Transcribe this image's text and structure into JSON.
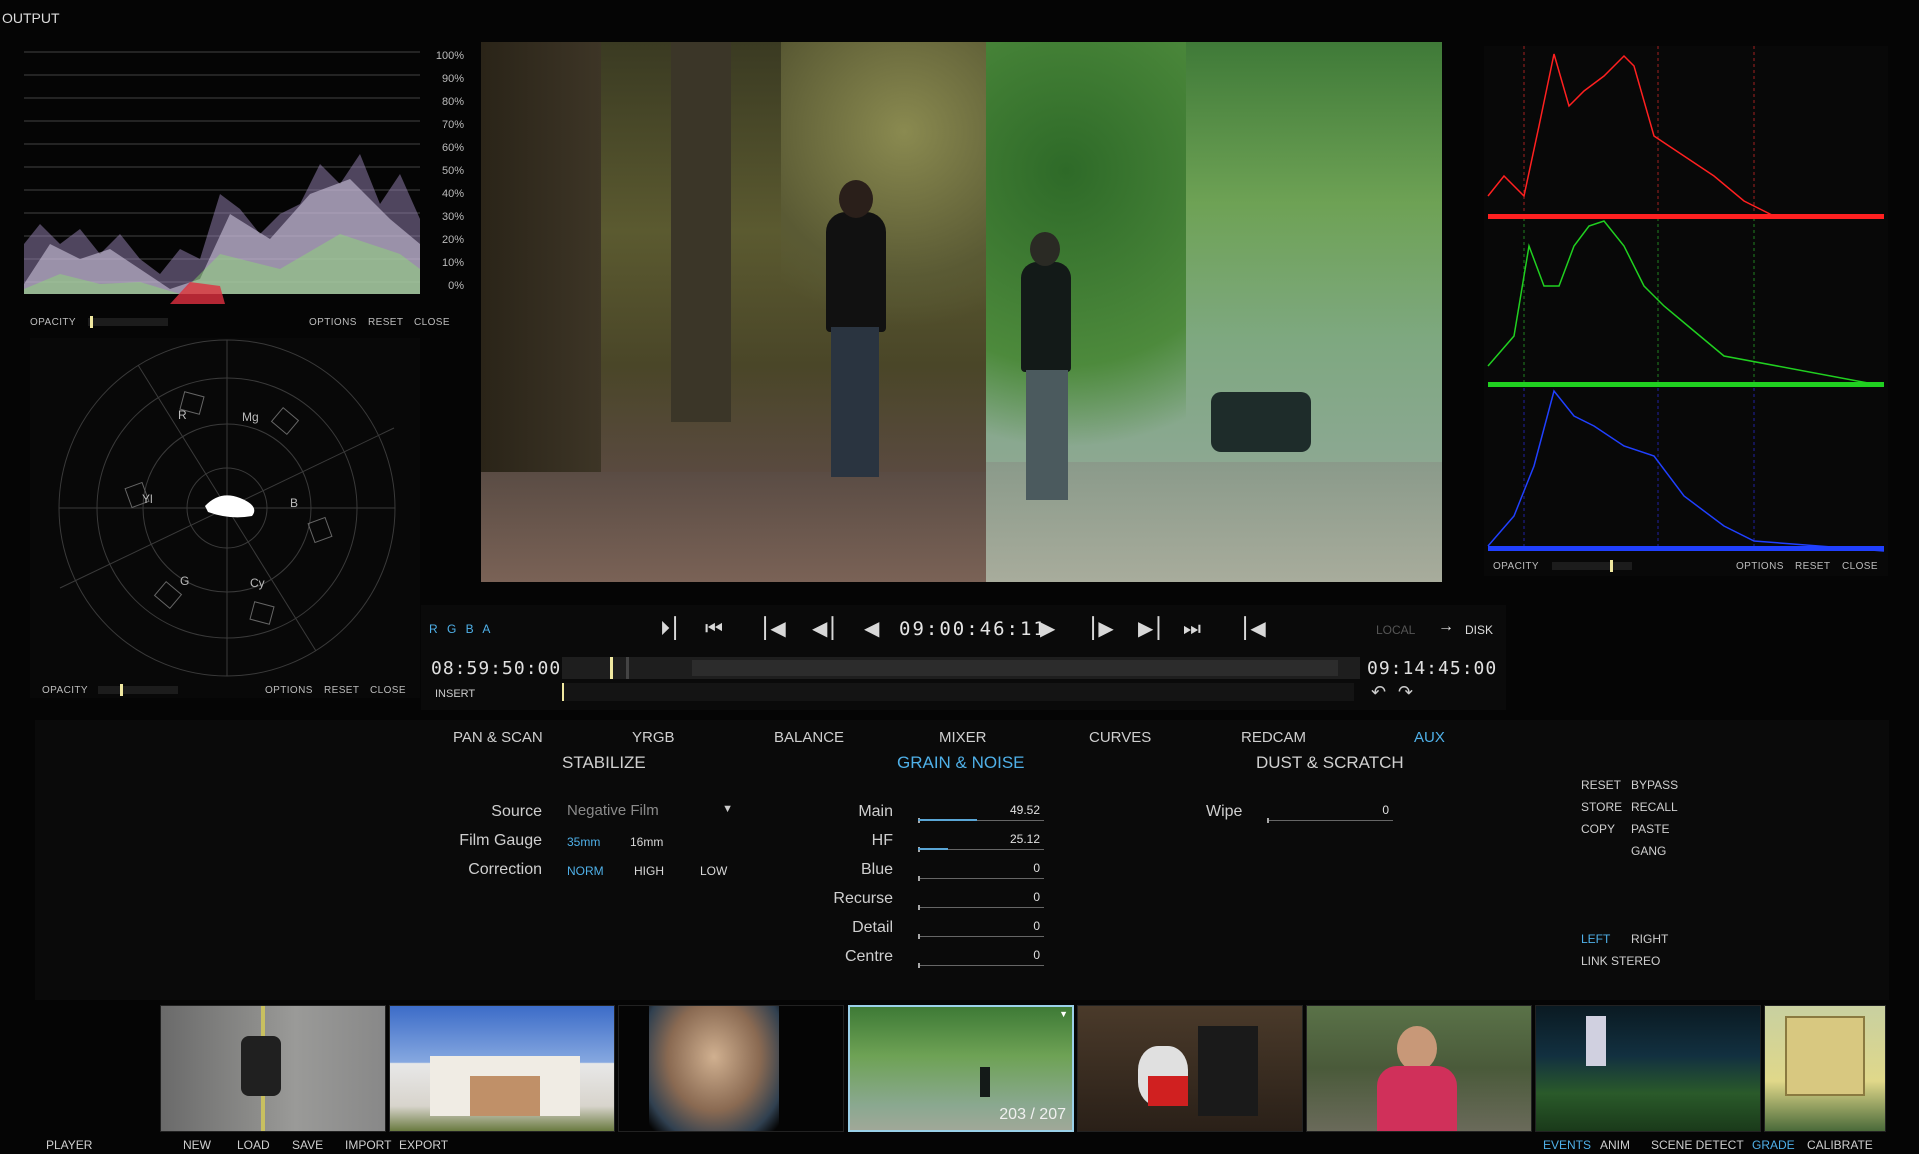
{
  "header": {
    "title": "OUTPUT"
  },
  "waveform": {
    "scale": [
      "100%",
      "90%",
      "80%",
      "70%",
      "60%",
      "50%",
      "40%",
      "30%",
      "20%",
      "10%",
      "0%"
    ],
    "opacity_label": "OPACITY",
    "options": "OPTIONS",
    "reset": "RESET",
    "close": "CLOSE"
  },
  "vectorscope": {
    "targets": [
      "R",
      "Mg",
      "B",
      "Cy",
      "G",
      "Yl"
    ],
    "opacity_label": "OPACITY",
    "options": "OPTIONS",
    "reset": "RESET",
    "close": "CLOSE"
  },
  "histogram": {
    "opacity_label": "OPACITY",
    "options": "OPTIONS",
    "reset": "RESET",
    "close": "CLOSE",
    "colors": {
      "red": "#ff2020",
      "green": "#20d020",
      "blue": "#2040ff"
    }
  },
  "transport": {
    "channels": "R G B A",
    "timecode": "09:00:46:11",
    "local": "LOCAL",
    "disk": "DISK",
    "start_tc": "08:59:50:00",
    "end_tc": "09:14:45:00",
    "insert": "INSERT"
  },
  "tabs": [
    "PAN & SCAN",
    "YRGB",
    "BALANCE",
    "MIXER",
    "CURVES",
    "REDCAM",
    "AUX"
  ],
  "active_tab": "AUX",
  "sections": {
    "stabilize": "STABILIZE",
    "grain": "GRAIN & NOISE",
    "dust": "DUST & SCRATCH"
  },
  "stabilize": {
    "source_label": "Source",
    "source_value": "Negative Film",
    "gauge_label": "Film Gauge",
    "gauge_options": [
      "35mm",
      "16mm"
    ],
    "correction_label": "Correction",
    "correction_options": [
      "NORM",
      "HIGH",
      "LOW"
    ]
  },
  "grain": {
    "sliders": [
      {
        "label": "Main",
        "value": "49.52",
        "level": 0.4952
      },
      {
        "label": "HF",
        "value": "25.12",
        "level": 0.2512
      },
      {
        "label": "Blue",
        "value": "0",
        "level": 0
      },
      {
        "label": "Recurse",
        "value": "0",
        "level": 0
      },
      {
        "label": "Detail",
        "value": "0",
        "level": 0
      },
      {
        "label": "Centre",
        "value": "0",
        "level": 0
      }
    ]
  },
  "dust": {
    "wipe_label": "Wipe",
    "wipe_value": "0"
  },
  "side": {
    "reset": "RESET",
    "bypass": "BYPASS",
    "store": "STORE",
    "recall": "RECALL",
    "copy": "COPY",
    "paste": "PASTE",
    "gang": "GANG",
    "left": "LEFT",
    "right": "RIGHT",
    "link_stereo": "LINK STEREO"
  },
  "thumbnails": {
    "counter": "203 / 207"
  },
  "footer": {
    "player": "PLAYER",
    "left": [
      "NEW",
      "LOAD",
      "SAVE",
      "IMPORT",
      "EXPORT"
    ],
    "right": [
      "EVENTS",
      "ANIM",
      "SCENE DETECT",
      "GRADE",
      "CALIBRATE"
    ],
    "active": "GRADE"
  },
  "colors": {
    "accent": "#4fb0e8",
    "text": "#cfcfcf",
    "background": "#050505"
  }
}
